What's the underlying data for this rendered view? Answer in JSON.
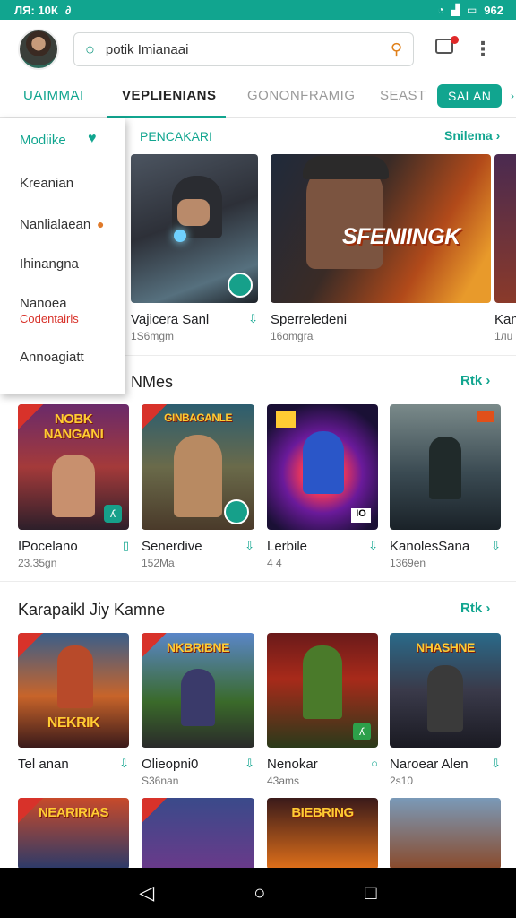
{
  "status_bar": {
    "time": "ЛЯ: 10К",
    "indicator": "∂",
    "right_text": "962"
  },
  "search": {
    "value": "potik Imianaai"
  },
  "tabs": [
    "UAIMMAI",
    "VEPLIENIANS",
    "GONONFRAMIG",
    "SEAST",
    "SALAN"
  ],
  "drawer": {
    "items": [
      "Modiike",
      "Kreanian",
      "Nanlialaean",
      "Ihinangna",
      "Nanoea",
      "Codentairls",
      "Annoagiatt"
    ]
  },
  "featured": {
    "label": "PENCAKARI",
    "see_all": "Snilema",
    "cards": [
      {
        "name": "Vajicera Sanl",
        "size": "1S6mgm"
      },
      {
        "name": "Sperreledeni",
        "size": "16omgra",
        "art_title": "SFENIINGK"
      },
      {
        "name": "Kan",
        "size": "1лu"
      }
    ]
  },
  "section_one": {
    "title": "NMes",
    "see_all": "Rtk",
    "cards": [
      {
        "name": "IPocelano",
        "size": "23.35gn",
        "art_title": "NOBK NANGANI"
      },
      {
        "name": "Senerdive",
        "size": "152Ma",
        "art_title": "GINBAGANLE"
      },
      {
        "name": "Lerbile",
        "size": "4 4",
        "art_title": "IO"
      },
      {
        "name": "KanolesSana",
        "size": "1369en"
      }
    ]
  },
  "section_two": {
    "title": "Karapaikl Jiy Kamne",
    "see_all": "Rtk",
    "cards": [
      {
        "name": "Tel anan",
        "size": "",
        "art_title": "NEKRIK"
      },
      {
        "name": "Olieopni0",
        "size": "S36nan",
        "art_title": "NKBRIBNE"
      },
      {
        "name": "Nenokar",
        "size": "43ams"
      },
      {
        "name": "Naroear Alen",
        "size": "2s10",
        "art_title": "NHASHNE"
      }
    ]
  },
  "section_three": {
    "cards": [
      {
        "art_title": "NEARIRIAS"
      },
      {
        "art_title": ""
      },
      {
        "art_title": "BIEBRING"
      },
      {
        "art_title": ""
      }
    ]
  }
}
